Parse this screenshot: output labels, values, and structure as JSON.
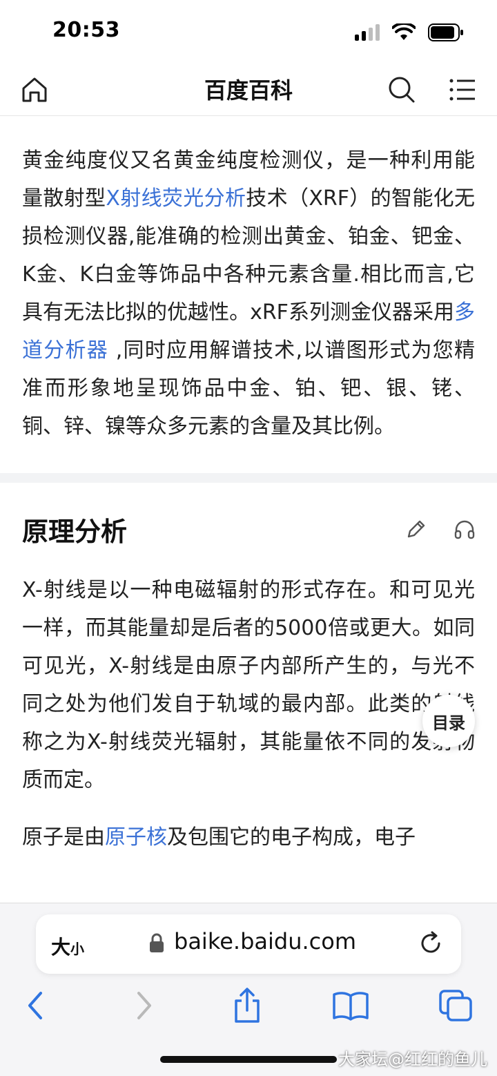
{
  "status_bar": {
    "time": "20:53"
  },
  "nav": {
    "title": "百度百科",
    "home_icon": "home-icon",
    "search_icon": "search-icon",
    "menu_icon": "menu-icon"
  },
  "intro": {
    "p1_a": "黄金纯度仪又名黄金纯度检测仪，是一种利用能量散射型",
    "p1_link1": "X射线荧光分析",
    "p1_b": "技术（XRF）的智能化无损检测仪器,能准确的检测出黄金、铂金、钯金、K金、K白金等饰品中各种元素含量.相比而言,它具有无法比拟的优越性。xRF系列测金仪器采用",
    "p1_link2": "多道分析器",
    "p1_c": " ,同时应用解谱技术,以谱图形式为您精准而形象地呈现饰品中金、铂、钯、银、铑、铜、锌、镍等众多元素的含量及其比例。"
  },
  "section": {
    "title": "原理分析",
    "edit_icon": "pencil-icon",
    "listen_icon": "headphones-icon",
    "p1": "X-射线是以一种电磁辐射的形式存在。和可见光一样，而其能量却是后者的5000倍或更大。如同可见光，X-射线是由原子内部所产生的，与光不同之处为他们发自于轨域的最内部。此类的射线称之为X-射线荧光辐射，其能量依不同的发射物质而定。",
    "p2_a": "原子是由",
    "p2_link": "原子核",
    "p2_b": "及包围它的电子构成，电子"
  },
  "toc": {
    "label": "目录"
  },
  "browser": {
    "size_label_big": "大",
    "size_label_small": "小",
    "url": "baike.baidu.com"
  },
  "watermark": "大家坛@红红的鱼儿",
  "colors": {
    "link": "#3b71d6",
    "text": "#222222"
  }
}
